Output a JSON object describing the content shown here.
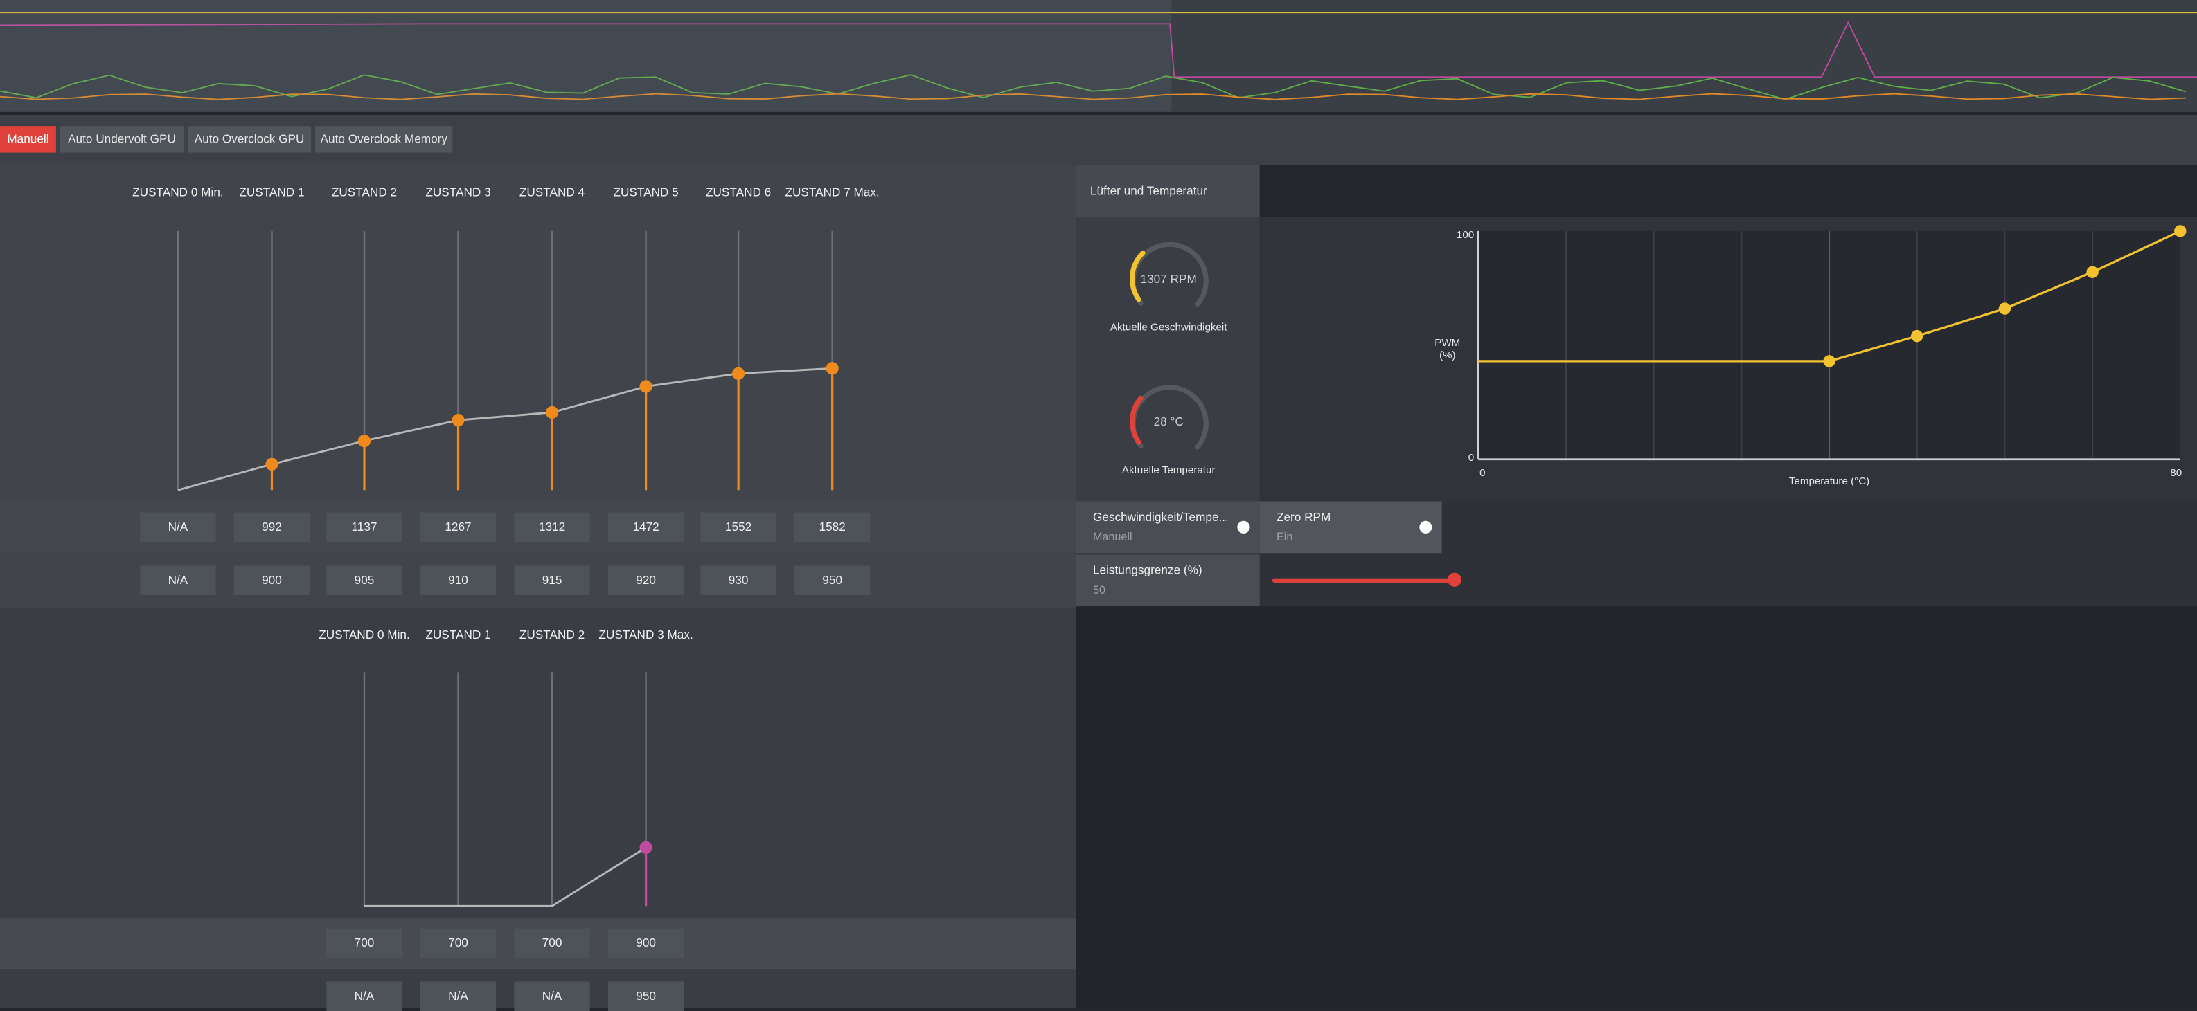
{
  "tabs": [
    {
      "label": "Manuell",
      "active": true
    },
    {
      "label": "Auto Undervolt GPU",
      "active": false
    },
    {
      "label": "Auto Overclock GPU",
      "active": false
    },
    {
      "label": "Auto Overclock Memory",
      "active": false
    }
  ],
  "gpu": {
    "states": [
      "ZUSTAND 0 Min.",
      "ZUSTAND 1",
      "ZUSTAND 2",
      "ZUSTAND 3",
      "ZUSTAND 4",
      "ZUSTAND 5",
      "ZUSTAND 6",
      "ZUSTAND 7 Max."
    ],
    "frequency": [
      "N/A",
      "992",
      "1137",
      "1267",
      "1312",
      "1472",
      "1552",
      "1582"
    ],
    "voltage": [
      "N/A",
      "900",
      "905",
      "910",
      "915",
      "920",
      "930",
      "950"
    ],
    "curve_level": [
      0,
      0.1,
      0.19,
      0.27,
      0.3,
      0.4,
      0.45,
      0.47
    ],
    "active_from_state": 1,
    "accent": "#f08a1c"
  },
  "memory": {
    "states": [
      "ZUSTAND 0 Min.",
      "ZUSTAND 1",
      "ZUSTAND 2",
      "ZUSTAND 3 Max."
    ],
    "frequency": [
      "700",
      "700",
      "700",
      "900"
    ],
    "voltage": [
      "N/A",
      "N/A",
      "N/A",
      "950"
    ],
    "curve_level": [
      0,
      0,
      0,
      0.25
    ],
    "active_from_state": 3,
    "accent": "#c04aa0"
  },
  "fan": {
    "header": "Lüfter und Temperatur",
    "speed": {
      "value": "1307 RPM",
      "caption": "Aktuelle Geschwindigkeit",
      "fill": 0.32,
      "color": "#f2c230"
    },
    "temperature": {
      "value": "28 °C",
      "caption": "Aktuelle Temperatur",
      "fill": 0.3,
      "color": "#e0413a"
    }
  },
  "chart_data": {
    "type": "line",
    "xlabel": "Temperature (°C)",
    "ylabel": [
      "PWM",
      "(%)"
    ],
    "xlim": [
      0,
      80
    ],
    "ylim": [
      0,
      100
    ],
    "xticks": [
      "0",
      "80"
    ],
    "yticks": [
      "100",
      "0"
    ],
    "grid": true,
    "color": "#f2c230",
    "series": [
      {
        "x": [
          0,
          40,
          50,
          60,
          70,
          80
        ],
        "y": [
          43,
          43,
          54,
          66,
          82,
          100
        ]
      }
    ]
  },
  "settings": {
    "fan_mode": {
      "title": "Geschwindigkeit/Tempe...",
      "value": "Manuell"
    },
    "zero_rpm": {
      "title": "Zero RPM",
      "value": "Ein"
    },
    "power_limit": {
      "title": "Leistungsgrenze (%)",
      "value": "50",
      "level": 1.0,
      "color": "#e0413a"
    }
  },
  "monitor_colors": {
    "yellow": "#d8c040",
    "magenta": "#c04aa0",
    "green": "#5fae4a",
    "orange": "#e08a2a"
  }
}
